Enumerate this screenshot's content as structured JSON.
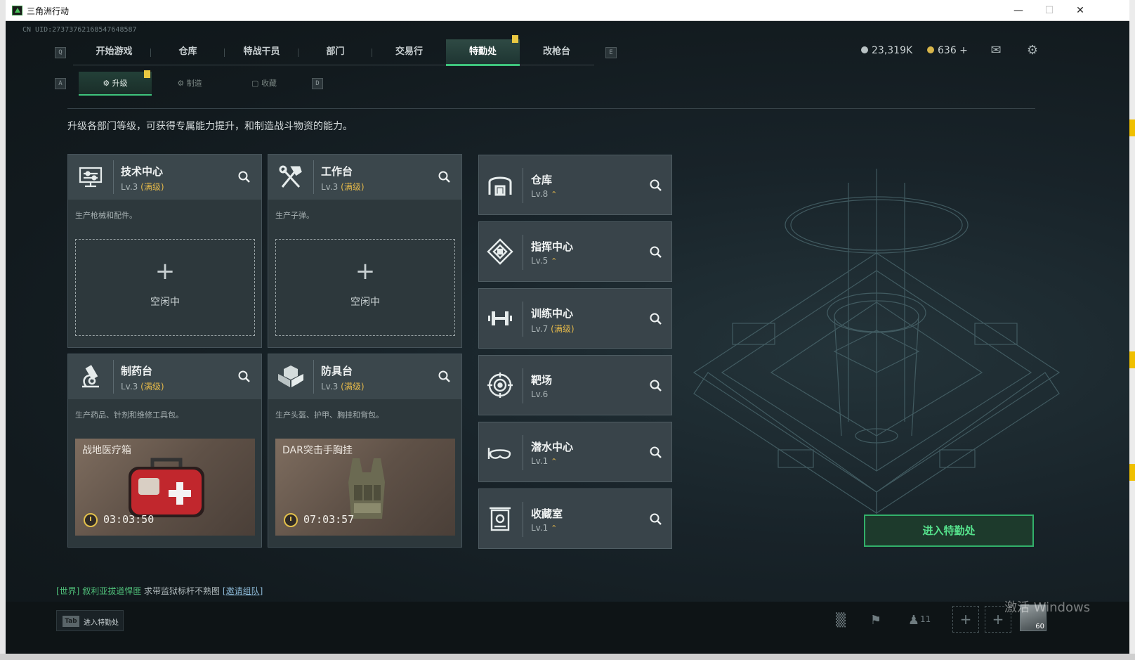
{
  "window": {
    "title": "三角洲行动"
  },
  "uid": "CN UID:27373762168547648587",
  "main_tabs": [
    {
      "label": "开始游戏",
      "active": false
    },
    {
      "label": "仓库",
      "active": false
    },
    {
      "label": "特战干员",
      "active": false
    },
    {
      "label": "部门",
      "active": false
    },
    {
      "label": "交易行",
      "active": false
    },
    {
      "label": "特勤处",
      "active": true
    },
    {
      "label": "改枪台",
      "active": false
    }
  ],
  "key_hints": {
    "tab_left": "Q",
    "tab_right": "E",
    "sub_left": "A",
    "sub_right": "D"
  },
  "sub_tabs": [
    {
      "label": "升级",
      "active": true
    },
    {
      "label": "制造",
      "active": false
    },
    {
      "label": "收藏",
      "active": false
    }
  ],
  "currency": {
    "money": "23,319K",
    "coins": "636 +"
  },
  "description": "升级各部门等级，可获得专属能力提升，和制造战斗物资的能力。",
  "workshops": [
    {
      "name": "技术中心",
      "level": "Lv.3",
      "max": "(满级)",
      "desc": "生产枪械和配件。",
      "status": "idle",
      "idle_text": "空闲中",
      "icon": "monitor-icon"
    },
    {
      "name": "工作台",
      "level": "Lv.3",
      "max": "(满级)",
      "desc": "生产子弹。",
      "status": "idle",
      "idle_text": "空闲中",
      "icon": "tools-icon"
    },
    {
      "name": "制药台",
      "level": "Lv.3",
      "max": "(满级)",
      "desc": "生产药品、针剂和维修工具包。",
      "status": "producing",
      "item": "战地医疗箱",
      "timer": "03:03:50",
      "icon": "microscope-icon"
    },
    {
      "name": "防具台",
      "level": "Lv.3",
      "max": "(满级)",
      "desc": "生产头盔、护甲、胸挂和背包。",
      "status": "producing",
      "item": "DAR突击手胸挂",
      "timer": "07:03:57",
      "icon": "armor-icon"
    }
  ],
  "facilities": [
    {
      "name": "仓库",
      "level": "Lv.8",
      "extra": "",
      "upgradable": true,
      "icon": "warehouse-icon"
    },
    {
      "name": "指挥中心",
      "level": "Lv.5",
      "extra": "",
      "upgradable": true,
      "icon": "command-icon"
    },
    {
      "name": "训练中心",
      "level": "Lv.7",
      "extra": "(满级)",
      "upgradable": false,
      "icon": "dumbbell-icon"
    },
    {
      "name": "靶场",
      "level": "Lv.6",
      "extra": "",
      "upgradable": false,
      "icon": "target-icon"
    },
    {
      "name": "潜水中心",
      "level": "Lv.1",
      "extra": "",
      "upgradable": true,
      "icon": "goggles-icon"
    },
    {
      "name": "收藏室",
      "level": "Lv.1",
      "extra": "",
      "upgradable": true,
      "icon": "collection-icon"
    }
  ],
  "enter_button": "进入特勤处",
  "chat": {
    "channel": "[世界]",
    "sender": "叙利亚拔道悍匪",
    "message": "求带监狱标杆不熟图",
    "link": "[邀请组队]"
  },
  "bottom": {
    "tab_key": "Tab",
    "tab_label": "进入特勤处",
    "friends_count": "11",
    "avatar_level": "60"
  },
  "watermark": "激活 Windows",
  "colors": {
    "accent": "#3ec47c",
    "gold": "#e3b84a",
    "background": "#141c20"
  }
}
